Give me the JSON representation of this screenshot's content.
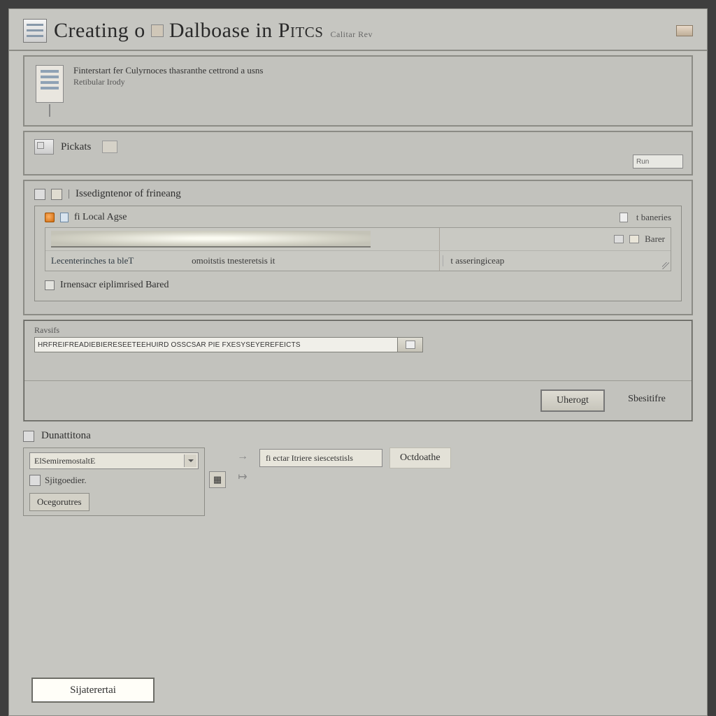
{
  "header": {
    "title_prefix": "Creating o",
    "title_mid": "Dalboase",
    "title_in": "in",
    "title_caps": "Pitcs",
    "subtitle": "Calitar Rev"
  },
  "intro": {
    "line": "Finterstart fer Culyrnoces thasranthe cettrond a usns",
    "sub": "Retibular Irody"
  },
  "picks": {
    "label": "Pickats",
    "field": "Run"
  },
  "assignment": {
    "heading": "Issedigntenor of frineang",
    "local_label": "fi Local Agse",
    "col_right": "t baneries",
    "row_barer": "Barer",
    "cell_a": "Lecenterinches ta bleT",
    "cell_b": "omoitstis tnesteretsis  it",
    "cell_c": "t asseringiceap",
    "checkbox": "Irnensacr eiplimrised Bared"
  },
  "status": {
    "label": "Ravsifs",
    "value": "HRFREIFREADIEBIERESEETEEHUIRD OSSCSAR PIE FXESYSEYEREFEICTS"
  },
  "actions": {
    "primary": "Uherogt",
    "secondary": "Sbesitifre"
  },
  "bottom": {
    "heading": "Dunattitona",
    "select_value": "ElSemiremostaltE",
    "list_item": "Sjitgoedier.",
    "pill": "Ocegorutres",
    "ro_field": "fi ectar Itriere siescetstisls",
    "big_action": "Octdoathe"
  },
  "footer": {
    "button": "Sijaterertai"
  }
}
